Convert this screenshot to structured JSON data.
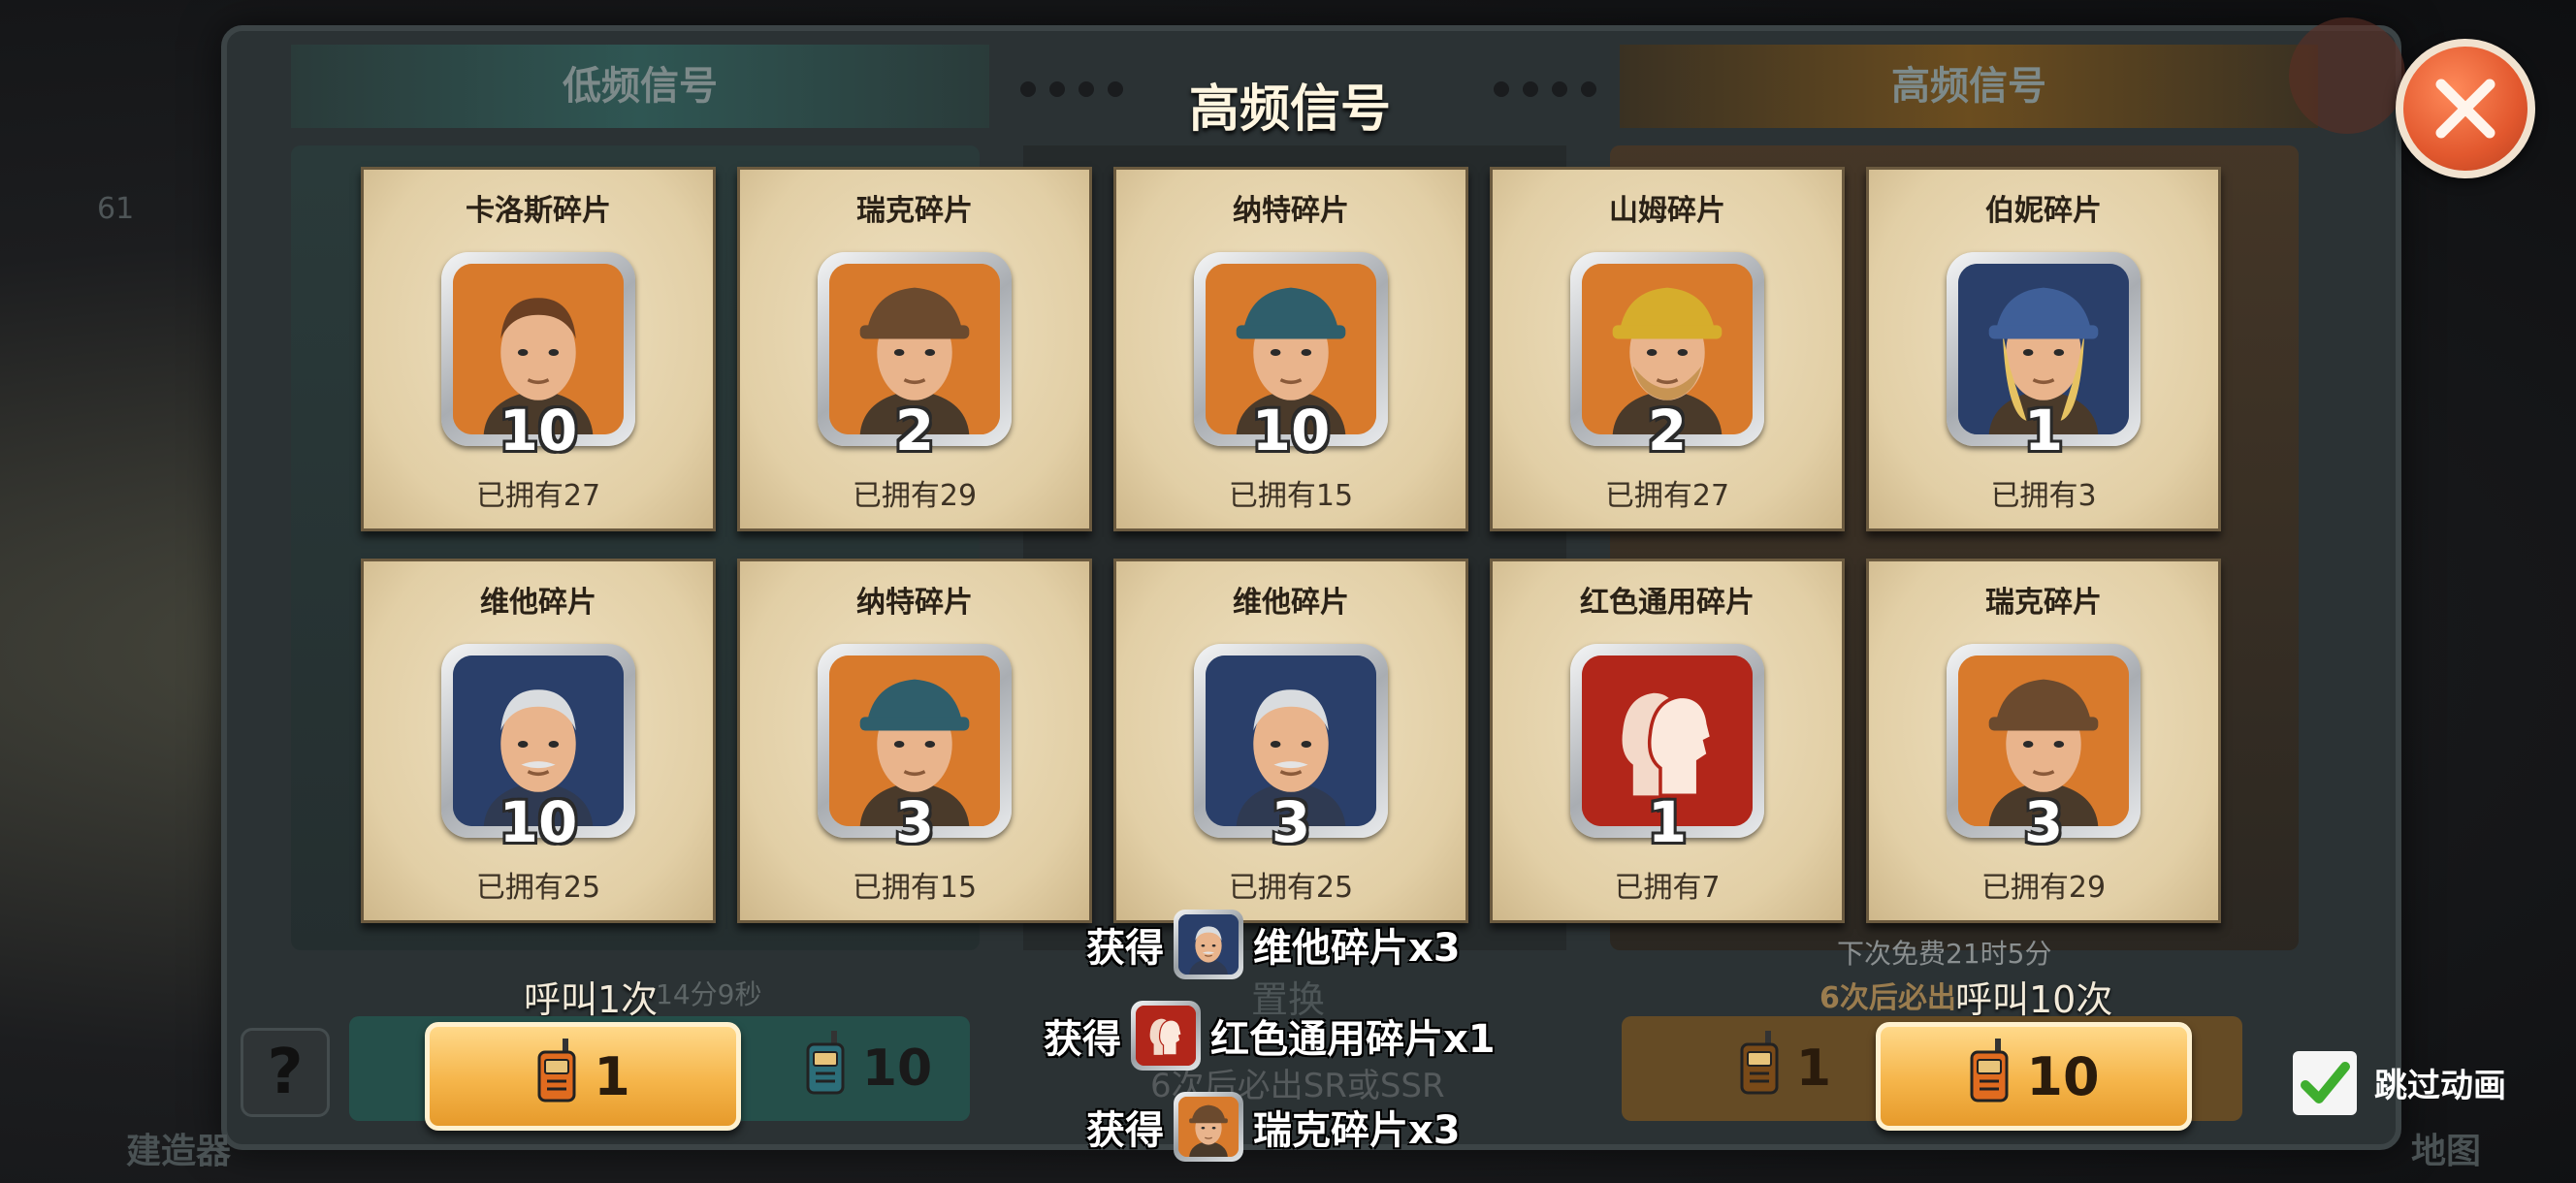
{
  "header": {
    "title": "高频信号",
    "left_tab": "低频信号",
    "right_tab": "高频信号"
  },
  "cards": [
    {
      "name": "卡洛斯碎片",
      "count": "10",
      "owned": "已拥有27",
      "portrait": "carlos-portrait"
    },
    {
      "name": "瑞克碎片",
      "count": "2",
      "owned": "已拥有29",
      "portrait": "rick-portrait"
    },
    {
      "name": "纳特碎片",
      "count": "10",
      "owned": "已拥有15",
      "portrait": "nate-portrait"
    },
    {
      "name": "山姆碎片",
      "count": "2",
      "owned": "已拥有27",
      "portrait": "sam-portrait"
    },
    {
      "name": "伯妮碎片",
      "count": "1",
      "owned": "已拥有3",
      "portrait": "bernie-portrait"
    },
    {
      "name": "维他碎片",
      "count": "10",
      "owned": "已拥有25",
      "portrait": "vita-portrait"
    },
    {
      "name": "纳特碎片",
      "count": "3",
      "owned": "已拥有15",
      "portrait": "nate-portrait"
    },
    {
      "name": "维他碎片",
      "count": "3",
      "owned": "已拥有25",
      "portrait": "vita-portrait"
    },
    {
      "name": "红色通用碎片",
      "count": "1",
      "owned": "已拥有7",
      "portrait": "universal-shard-icon"
    },
    {
      "name": "瑞克碎片",
      "count": "3",
      "owned": "已拥有29",
      "portrait": "rick-portrait"
    }
  ],
  "rewards": [
    {
      "prefix": "获得",
      "text": "维他碎片x3",
      "icon": "vita-portrait"
    },
    {
      "prefix": "获得",
      "text": "红色通用碎片x1",
      "icon": "universal-shard-icon"
    },
    {
      "prefix": "获得",
      "text": "瑞克碎片x3",
      "icon": "rick-portrait"
    }
  ],
  "controls": {
    "call_once_label": "呼叫1次",
    "call_ten_label": "呼叫10次",
    "call_once_cost": "1",
    "call_ten_cost": "10",
    "left_dim_cost_1": "1",
    "left_dim_cost_10": "10",
    "right_dim_cost_1": "1",
    "left_timer_faded": "14分9秒",
    "right_free_timer": "下次免费21时5分",
    "right_guarantee": "6次后必出",
    "swap_label": "置换",
    "bottom_guarantee": "6次后必出SR或SSR",
    "skip_label": "跳过动画",
    "skip_checked": true
  },
  "background": {
    "builder_label": "建造器",
    "map_label": "地图",
    "level_badge": "61"
  },
  "colors": {
    "gold": "#f5b54a",
    "close": "#e2582e",
    "card_bg": "#e7d6b0"
  }
}
